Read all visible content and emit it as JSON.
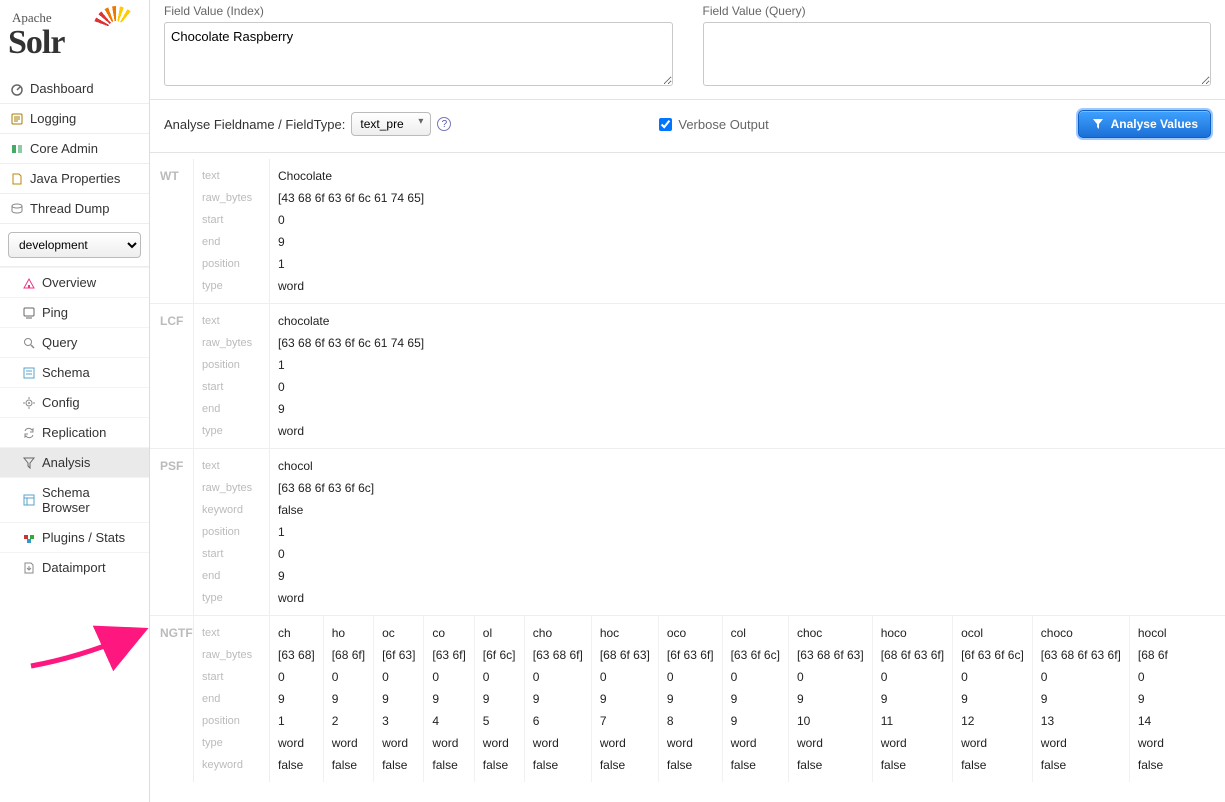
{
  "logo": {
    "brand_top": "Apache",
    "brand_main": "Solr"
  },
  "nav": [
    {
      "label": "Dashboard",
      "icon": "dashboard-icon",
      "color": "#666"
    },
    {
      "label": "Logging",
      "icon": "logging-icon",
      "color": "#a67c00"
    },
    {
      "label": "Core Admin",
      "icon": "core-admin-icon",
      "color": "#4a6"
    },
    {
      "label": "Java Properties",
      "icon": "java-props-icon",
      "color": "#b80"
    },
    {
      "label": "Thread Dump",
      "icon": "thread-dump-icon",
      "color": "#888"
    }
  ],
  "core_selector": {
    "selected": "development"
  },
  "subnav": [
    {
      "label": "Overview",
      "icon": "overview-icon",
      "color": "#e38"
    },
    {
      "label": "Ping",
      "icon": "ping-icon",
      "color": "#666"
    },
    {
      "label": "Query",
      "icon": "query-icon",
      "color": "#888"
    },
    {
      "label": "Schema",
      "icon": "schema-icon",
      "color": "#57a3c9"
    },
    {
      "label": "Config",
      "icon": "config-icon",
      "color": "#888"
    },
    {
      "label": "Replication",
      "icon": "replication-icon",
      "color": "#888"
    },
    {
      "label": "Analysis",
      "icon": "analysis-icon",
      "active": true,
      "color": "#666"
    },
    {
      "label": "Schema Browser",
      "icon": "schema-browser-icon",
      "color": "#57a3c9"
    },
    {
      "label": "Plugins / Stats",
      "icon": "plugins-icon",
      "color": "#c33"
    },
    {
      "label": "Dataimport",
      "icon": "dataimport-icon",
      "color": "#888"
    }
  ],
  "inputs": {
    "index_label": "Field Value (Index)",
    "index_value": "Chocolate Raspberry",
    "query_label": "Field Value (Query)",
    "query_value": ""
  },
  "controls": {
    "analyse_label": "Analyse Fieldname / FieldType:",
    "fieldtype_selected": "text_pre",
    "verbose_label": "Verbose Output",
    "verbose_checked": true,
    "button_label": "Analyse Values"
  },
  "phases": [
    {
      "name": "WT",
      "attrs": [
        "text",
        "raw_bytes",
        "start",
        "end",
        "position",
        "type"
      ],
      "tokens": [
        {
          "text": "Chocolate",
          "raw_bytes": "[43 68 6f 63 6f 6c 61 74 65]",
          "start": "0",
          "end": "9",
          "position": "1",
          "type": "word"
        }
      ]
    },
    {
      "name": "LCF",
      "attrs": [
        "text",
        "raw_bytes",
        "position",
        "start",
        "end",
        "type"
      ],
      "tokens": [
        {
          "text": "chocolate",
          "raw_bytes": "[63 68 6f 63 6f 6c 61 74 65]",
          "position": "1",
          "start": "0",
          "end": "9",
          "type": "word"
        }
      ]
    },
    {
      "name": "PSF",
      "attrs": [
        "text",
        "raw_bytes",
        "keyword",
        "position",
        "start",
        "end",
        "type"
      ],
      "tokens": [
        {
          "text": "chocol",
          "raw_bytes": "[63 68 6f 63 6f 6c]",
          "keyword": "false",
          "position": "1",
          "start": "0",
          "end": "9",
          "type": "word"
        }
      ]
    },
    {
      "name": "NGTF",
      "attrs": [
        "text",
        "raw_bytes",
        "start",
        "end",
        "position",
        "type",
        "keyword"
      ],
      "tokens": [
        {
          "text": "ch",
          "raw_bytes": "[63 68]",
          "start": "0",
          "end": "9",
          "position": "1",
          "type": "word",
          "keyword": "false"
        },
        {
          "text": "ho",
          "raw_bytes": "[68 6f]",
          "start": "0",
          "end": "9",
          "position": "2",
          "type": "word",
          "keyword": "false"
        },
        {
          "text": "oc",
          "raw_bytes": "[6f 63]",
          "start": "0",
          "end": "9",
          "position": "3",
          "type": "word",
          "keyword": "false"
        },
        {
          "text": "co",
          "raw_bytes": "[63 6f]",
          "start": "0",
          "end": "9",
          "position": "4",
          "type": "word",
          "keyword": "false"
        },
        {
          "text": "ol",
          "raw_bytes": "[6f 6c]",
          "start": "0",
          "end": "9",
          "position": "5",
          "type": "word",
          "keyword": "false"
        },
        {
          "text": "cho",
          "raw_bytes": "[63 68 6f]",
          "start": "0",
          "end": "9",
          "position": "6",
          "type": "word",
          "keyword": "false"
        },
        {
          "text": "hoc",
          "raw_bytes": "[68 6f 63]",
          "start": "0",
          "end": "9",
          "position": "7",
          "type": "word",
          "keyword": "false"
        },
        {
          "text": "oco",
          "raw_bytes": "[6f 63 6f]",
          "start": "0",
          "end": "9",
          "position": "8",
          "type": "word",
          "keyword": "false"
        },
        {
          "text": "col",
          "raw_bytes": "[63 6f 6c]",
          "start": "0",
          "end": "9",
          "position": "9",
          "type": "word",
          "keyword": "false"
        },
        {
          "text": "choc",
          "raw_bytes": "[63 68 6f 63]",
          "start": "0",
          "end": "9",
          "position": "10",
          "type": "word",
          "keyword": "false"
        },
        {
          "text": "hoco",
          "raw_bytes": "[68 6f 63 6f]",
          "start": "0",
          "end": "9",
          "position": "11",
          "type": "word",
          "keyword": "false"
        },
        {
          "text": "ocol",
          "raw_bytes": "[6f 63 6f 6c]",
          "start": "0",
          "end": "9",
          "position": "12",
          "type": "word",
          "keyword": "false"
        },
        {
          "text": "choco",
          "raw_bytes": "[63 68 6f 63 6f]",
          "start": "0",
          "end": "9",
          "position": "13",
          "type": "word",
          "keyword": "false"
        },
        {
          "text": "hocol",
          "raw_bytes": "[68 6f",
          "start": "0",
          "end": "9",
          "position": "14",
          "type": "word",
          "keyword": "false"
        }
      ]
    }
  ]
}
